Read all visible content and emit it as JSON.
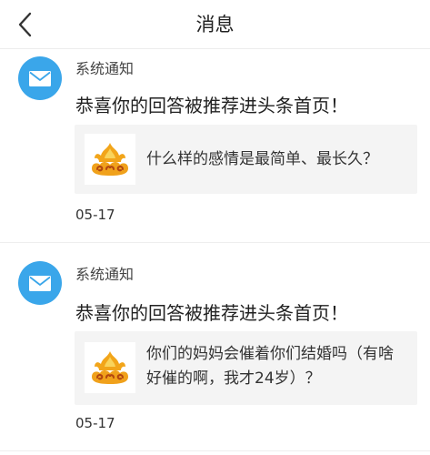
{
  "header": {
    "title": "消息",
    "back_icon": "chevron-left-icon"
  },
  "colors": {
    "avatar_blue": "#3aa6ea",
    "card_background": "#f4f4f4"
  },
  "messages": [
    {
      "sender": "系统通知",
      "avatar_icon": "mail-envelope-icon",
      "headline": "恭喜你的回答被推荐进头条首页！",
      "card": {
        "thumbnail_icon": "cloud-emblem-icon",
        "text": "什么样的感情是最简单、最长久？"
      },
      "date": "05-17"
    },
    {
      "sender": "系统通知",
      "avatar_icon": "mail-envelope-icon",
      "headline": "恭喜你的回答被推荐进头条首页！",
      "card": {
        "thumbnail_icon": "cloud-emblem-icon",
        "text": "你们的妈妈会催着你们结婚吗（有啥好催的啊，我才24岁）？"
      },
      "date": "05-17"
    }
  ]
}
